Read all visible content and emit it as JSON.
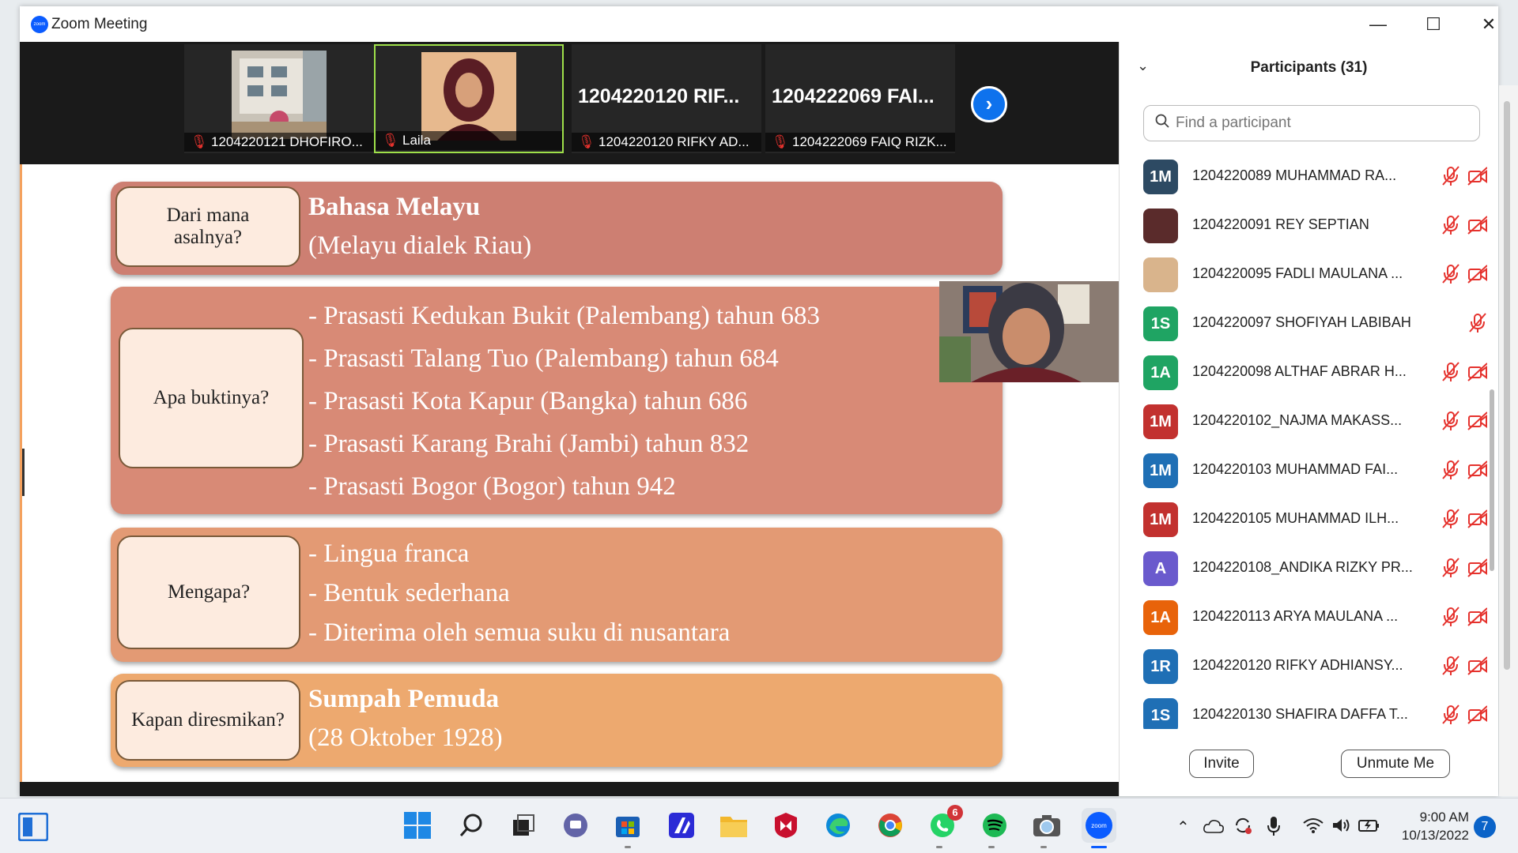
{
  "window": {
    "title": "Zoom Meeting",
    "minimize": "—",
    "maximize": "☐",
    "close": "✕"
  },
  "video_strip": {
    "tiles": [
      {
        "name": "1204220121 DHOFIRO..."
      },
      {
        "name": "Laila"
      },
      {
        "big_name": "1204220120  RIF...",
        "name": "1204220120 RIFKY AD..."
      },
      {
        "big_name": "1204222069  FAI...",
        "name": "1204222069 FAIQ RIZK..."
      }
    ],
    "next": "›"
  },
  "slide": {
    "rows": [
      {
        "question": [
          "Dari mana",
          "asalnya?"
        ],
        "heading": "Bahasa Melayu",
        "line": "(Melayu dialek Riau)",
        "color": "#cd7f72"
      },
      {
        "question": [
          "Apa buktinya?"
        ],
        "items": [
          "- Prasasti Kedukan Bukit (Palembang) tahun 683",
          "- Prasasti Talang Tuo (Palembang) tahun 684",
          "- Prasasti Kota Kapur (Bangka) tahun 686",
          "- Prasasti Karang Brahi (Jambi) tahun 832",
          "- Prasasti Bogor (Bogor) tahun 942"
        ],
        "color": "#d88a76"
      },
      {
        "question": [
          "Mengapa?"
        ],
        "items": [
          "- Lingua franca",
          "- Bentuk sederhana",
          "- Diterima oleh semua suku di nusantara"
        ],
        "color": "#e39a74"
      },
      {
        "question": [
          "Kapan diresmikan?"
        ],
        "heading": "Sumpah Pemuda",
        "line": "(28 Oktober 1928)",
        "color": "#eda96f"
      }
    ]
  },
  "participants": {
    "title": "Participants (31)",
    "search_placeholder": "Find a participant",
    "list": [
      {
        "initials": "1M",
        "name": "1204220089 MUHAMMAD RA...",
        "color": "#2d4a63",
        "video": true
      },
      {
        "initials": "",
        "name": "1204220091 REY SEPTIAN",
        "color": "#5a2b2b",
        "video": true
      },
      {
        "initials": "",
        "name": "1204220095 FADLI MAULANA ...",
        "color": "#d9b48c",
        "video": true
      },
      {
        "initials": "1S",
        "name": "1204220097 SHOFIYAH LABIBAH",
        "color": "#1fa463",
        "video": false
      },
      {
        "initials": "1A",
        "name": "1204220098 ALTHAF ABRAR H...",
        "color": "#1fa463",
        "video": true
      },
      {
        "initials": "1M",
        "name": "1204220102_NAJMA MAKASS...",
        "color": "#c2312f",
        "video": true
      },
      {
        "initials": "1M",
        "name": "1204220103 MUHAMMAD FAI...",
        "color": "#1f6fb5",
        "video": true
      },
      {
        "initials": "1M",
        "name": "1204220105 MUHAMMAD ILH...",
        "color": "#c2312f",
        "video": true
      },
      {
        "initials": "A",
        "name": "1204220108_ANDIKA RIZKY PR...",
        "color": "#6a5acd",
        "video": true
      },
      {
        "initials": "1A",
        "name": "1204220113 ARYA MAULANA ...",
        "color": "#e8630a",
        "video": true
      },
      {
        "initials": "1R",
        "name": "1204220120 RIFKY ADHIANSY...",
        "color": "#1f6fb5",
        "video": true
      },
      {
        "initials": "1S",
        "name": "1204220130 SHAFIRA DAFFA T...",
        "color": "#1f6fb5",
        "video": true
      }
    ],
    "invite": "Invite",
    "unmute": "Unmute Me"
  },
  "taskbar": {
    "whatsapp_badge": "6",
    "zoom_label": "zoom",
    "time": "9:00 AM",
    "date": "10/13/2022",
    "notifications": "7"
  },
  "colors": {
    "zoom_blue": "#0e72ed",
    "active_border": "#9fe04a",
    "mic_off": "#e5322d"
  }
}
